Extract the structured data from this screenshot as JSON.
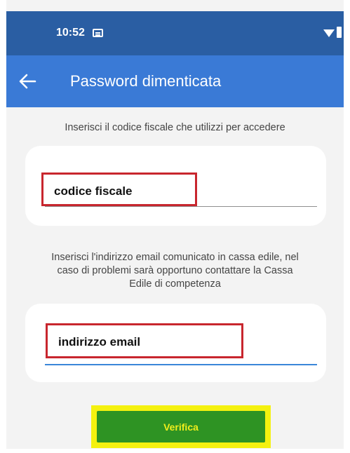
{
  "status_bar": {
    "time": "10:52"
  },
  "app_bar": {
    "title": "Password dimenticata"
  },
  "fiscal_section": {
    "instruction": "Inserisci il codice fiscale che utilizzi per accedere",
    "field_value": "codice fiscale"
  },
  "email_section": {
    "instruction_line1": "Inserisci l'indirizzo email comunicato in cassa edile, nel",
    "instruction_line2": "caso di problemi sarà opportuno contattare la Cassa",
    "instruction_line3": "Edile di competenza",
    "field_value": "indirizzo email"
  },
  "actions": {
    "verify_label": "Verifica"
  },
  "colors": {
    "status_bar": "#2a5ea3",
    "app_bar": "#3a7ad6",
    "button": "#2e9323",
    "button_highlight": "#f4f10f",
    "field_outline": "#c8262e"
  }
}
